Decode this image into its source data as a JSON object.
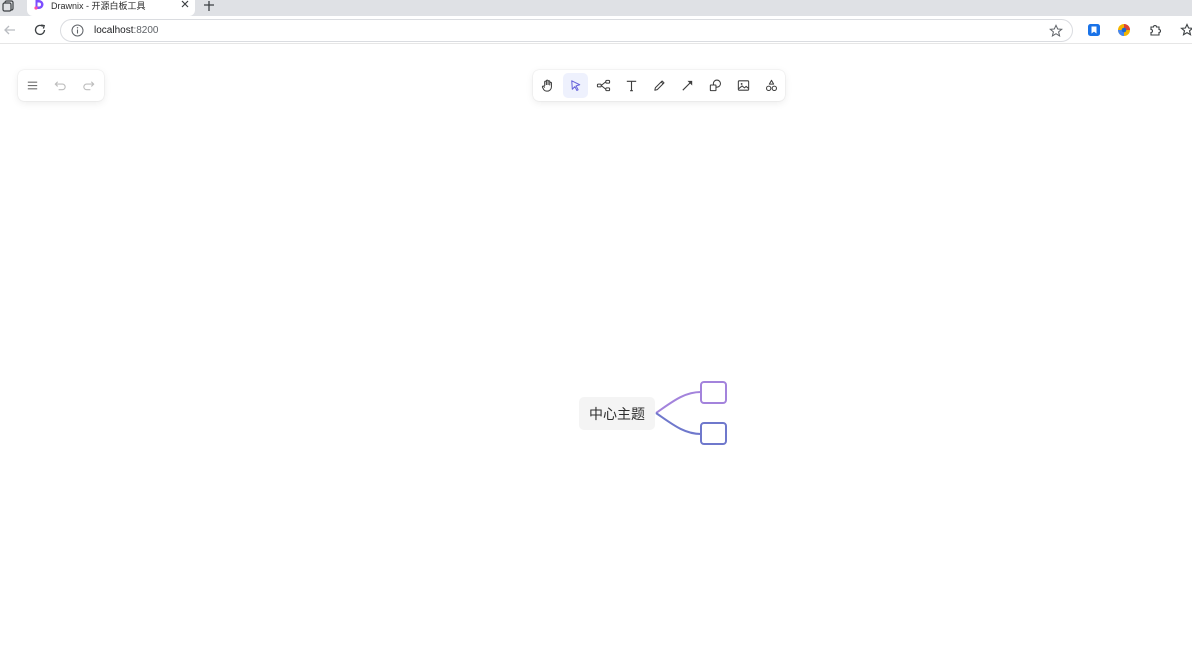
{
  "browser": {
    "tab": {
      "title": "Drawnix - 开源白板工具"
    },
    "address": {
      "host": "localhost",
      "port": ":8200"
    },
    "icons": [
      "tab-actions-icon",
      "drawnix-favicon",
      "close-icon",
      "plus-icon",
      "back-arrow-icon",
      "reload-icon",
      "info-icon",
      "star-icon",
      "extension-bookmark-icon",
      "extension-color-icon",
      "puzzle-icon",
      "favorites-icon"
    ]
  },
  "app": {
    "menu": {
      "items": [
        {
          "name": "menu",
          "icon": "hamburger-icon",
          "enabled": true
        },
        {
          "name": "undo",
          "icon": "undo-icon",
          "enabled": false
        },
        {
          "name": "redo",
          "icon": "redo-icon",
          "enabled": false
        }
      ]
    },
    "tools": {
      "items": [
        {
          "name": "hand",
          "icon": "hand-icon",
          "active": false
        },
        {
          "name": "selection",
          "icon": "pointer-icon",
          "active": true
        },
        {
          "name": "mind",
          "icon": "mindmap-icon",
          "active": false
        },
        {
          "name": "text",
          "icon": "text-icon",
          "active": false
        },
        {
          "name": "pen",
          "icon": "pen-icon",
          "active": false
        },
        {
          "name": "arrow",
          "icon": "arrow-icon",
          "active": false
        },
        {
          "name": "shape",
          "icon": "shapes-icon",
          "active": false
        },
        {
          "name": "image",
          "icon": "image-icon",
          "active": false
        },
        {
          "name": "extra",
          "icon": "extra-tools-icon",
          "active": false
        }
      ]
    },
    "canvas": {
      "mindmap": {
        "root": {
          "text": "中心主题"
        },
        "children": [
          {
            "text": ""
          },
          {
            "text": ""
          }
        ]
      }
    },
    "colors": {
      "accent": "#6965db",
      "branch_top": "#a383dc",
      "branch_bottom": "#6f78cc",
      "root_fill": "#f4f4f4"
    }
  }
}
